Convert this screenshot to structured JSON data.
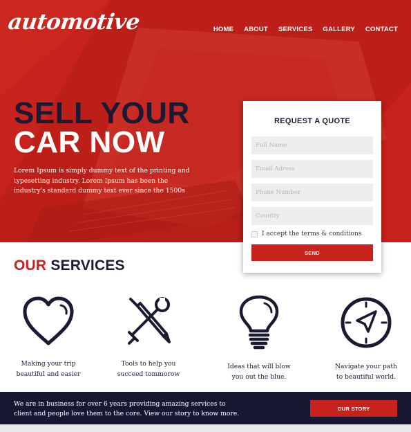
{
  "brand": {
    "logo_text": "automotive",
    "accent": "#c7221b",
    "navy": "#1a1a33"
  },
  "nav": {
    "items": [
      "HOME",
      "ABOUT",
      "SERVICES",
      "GALLERY",
      "CONTACT"
    ]
  },
  "hero": {
    "headline_line1": "SELL YOUR",
    "headline_line2": "CAR NOW",
    "text": "Lorem Ipsum is simply dummy text of the printing and typesetting industry. Lorem Ipsum has been the industry's standard dummy text ever since the 1500s"
  },
  "quote_form": {
    "title": "REQUEST A QUOTE",
    "full_name_placeholder": "Full Name",
    "email_placeholder": "Email Adress",
    "phone_placeholder": "Phone Number",
    "country_placeholder": "Country",
    "terms_label": "I accept the terms & conditions",
    "terms_checked": false,
    "send_label": "SEND"
  },
  "services": {
    "title_accent": "OUR",
    "title_rest": "SERVICES",
    "items": [
      {
        "icon": "heart-icon",
        "line1": "Making your trip",
        "line2": "beautiful and easier"
      },
      {
        "icon": "tools-icon",
        "line1": "Tools to help you",
        "line2": "succeed tommorow"
      },
      {
        "icon": "lightbulb-icon",
        "line1": "Ideas that will blow",
        "line2": "you out the blue."
      },
      {
        "icon": "compass-icon",
        "line1": "Navigate your path",
        "line2": "to beautiful world."
      }
    ]
  },
  "footer": {
    "text": "We are in business for over 6 years providing amazing services to client and people love them to the core. View our story to know more.",
    "button_label": "OUR STORY"
  }
}
